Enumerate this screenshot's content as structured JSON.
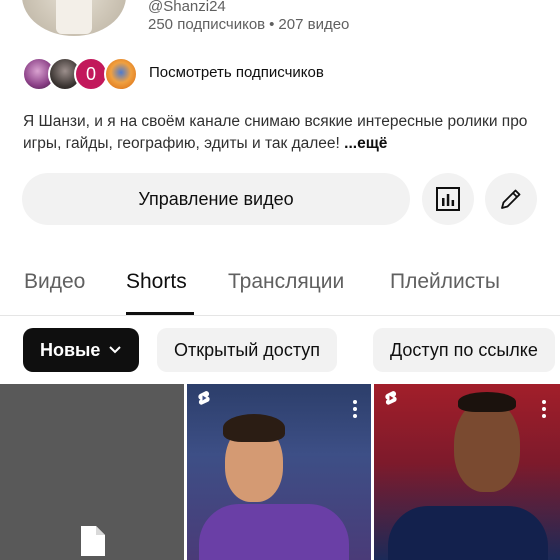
{
  "channel": {
    "handle": "@Shanzi24",
    "subscribers": "250 подписчиков",
    "separator": "•",
    "videos": "207 видео",
    "subscriber_badge_count": "0",
    "view_subscribers_label": "Посмотреть подписчиков",
    "description": "Я Шанзи, и я на своём канале снимаю всякие интересные ролики про игры, гайды, географию, эдиты и так далее!",
    "description_more": "...ещё"
  },
  "actions": {
    "manage_videos_label": "Управление видео",
    "stats_icon": "bar-chart-icon",
    "edit_icon": "pencil-icon"
  },
  "tabs": [
    {
      "label": "Видео",
      "active": false
    },
    {
      "label": "Shorts",
      "active": true
    },
    {
      "label": "Трансляции",
      "active": false
    },
    {
      "label": "Плейлисты",
      "active": false
    }
  ],
  "chips": [
    {
      "label": "Новые",
      "selected": true
    },
    {
      "label": "Открытый доступ",
      "selected": false
    },
    {
      "label": "Доступ по ссылке",
      "selected": false
    }
  ],
  "thumbnails": [
    {
      "kind": "processing",
      "icon": "file-icon"
    },
    {
      "kind": "short",
      "icon": "shorts-icon"
    },
    {
      "kind": "short",
      "icon": "shorts-icon"
    }
  ],
  "colors": {
    "accent": "#0f0f0f",
    "chip_bg": "#f2f2f2",
    "muted_text": "#606060",
    "badge_pink": "#c2185b"
  }
}
